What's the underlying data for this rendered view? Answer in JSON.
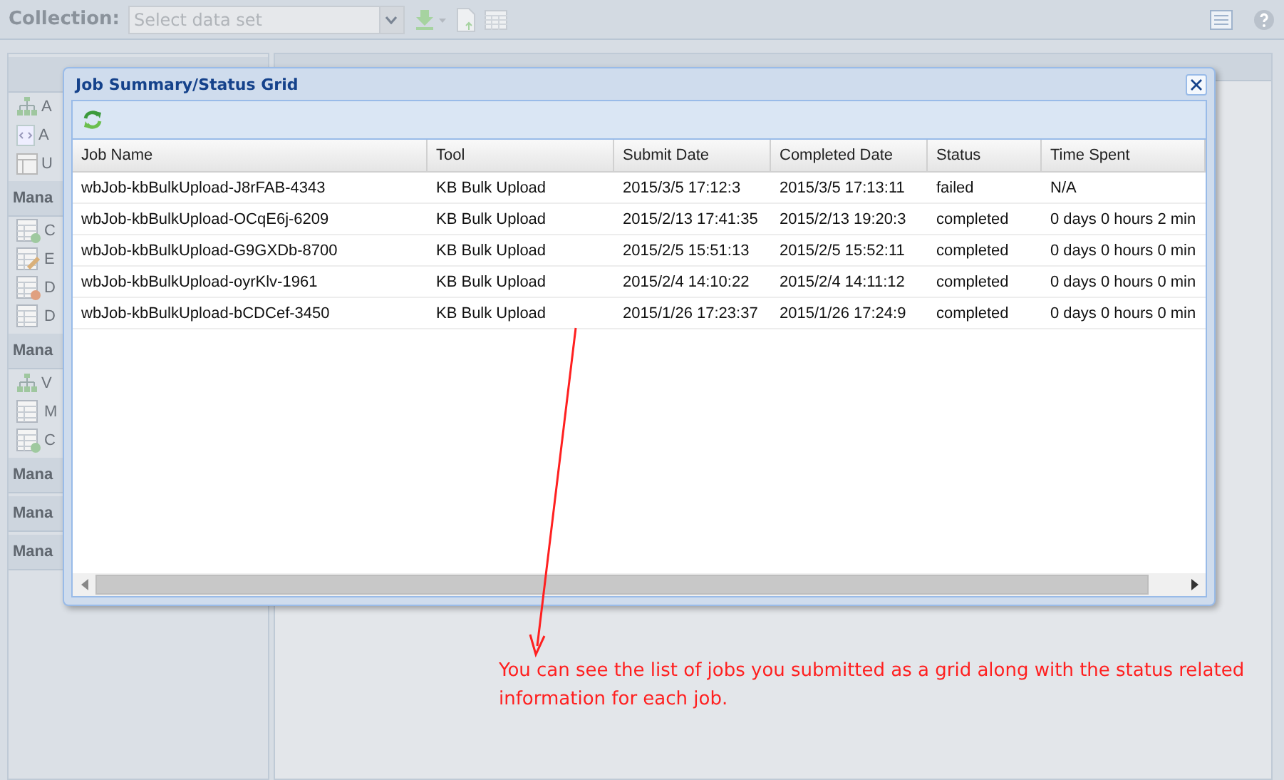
{
  "toolbar": {
    "label": "Collection:",
    "select": {
      "placeholder": "Select data set"
    }
  },
  "sidebar": {
    "sections": [
      {
        "items": [
          {
            "label": "A"
          },
          {
            "label": "A"
          },
          {
            "label": "U"
          }
        ]
      },
      {
        "title": "Mana",
        "items": [
          {
            "label": "C"
          },
          {
            "label": "E"
          },
          {
            "label": "D"
          },
          {
            "label": "D"
          }
        ]
      },
      {
        "title": "Mana",
        "items": [
          {
            "label": "V"
          },
          {
            "label": "M"
          },
          {
            "label": "C"
          }
        ]
      },
      {
        "title": "Mana"
      },
      {
        "title": "Mana"
      },
      {
        "title": "Mana"
      }
    ]
  },
  "dialog": {
    "title": "Job Summary/Status Grid",
    "table": {
      "columns": [
        "Job Name",
        "Tool",
        "Submit Date",
        "Completed Date",
        "Status",
        "Time Spent"
      ],
      "rows": [
        [
          "wbJob-kbBulkUpload-J8rFAB-4343",
          "KB Bulk Upload",
          "2015/3/5 17:12:3",
          "2015/3/5 17:13:11",
          "failed",
          "N/A"
        ],
        [
          "wbJob-kbBulkUpload-OCqE6j-6209",
          "KB Bulk Upload",
          "2015/2/13 17:41:35",
          "2015/2/13 19:20:3",
          "completed",
          "0 days 0 hours 2 min"
        ],
        [
          "wbJob-kbBulkUpload-G9GXDb-8700",
          "KB Bulk Upload",
          "2015/2/5 15:51:13",
          "2015/2/5 15:52:11",
          "completed",
          "0 days 0 hours 0 min"
        ],
        [
          "wbJob-kbBulkUpload-oyrKlv-1961",
          "KB Bulk Upload",
          "2015/2/4 14:10:22",
          "2015/2/4 14:11:12",
          "completed",
          "0 days 0 hours 0 min"
        ],
        [
          "wbJob-kbBulkUpload-bCDCef-3450",
          "KB Bulk Upload",
          "2015/1/26 17:23:37",
          "2015/1/26 17:24:9",
          "completed",
          "0 days 0 hours 0 min"
        ]
      ]
    }
  },
  "annotation": {
    "text": "You can see the list of jobs you submitted as a grid along with the status related information for each job."
  }
}
